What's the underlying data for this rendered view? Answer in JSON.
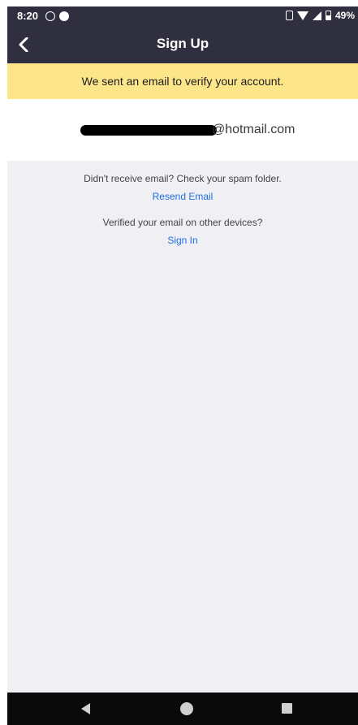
{
  "status_bar": {
    "time": "8:20",
    "battery": "49%",
    "icons": [
      "whatsapp-icon",
      "messenger-icon",
      "vibrate-icon",
      "wifi-icon",
      "signal-icon",
      "battery-icon"
    ]
  },
  "header": {
    "title": "Sign Up",
    "back_icon": "chevron-left-icon"
  },
  "banner": {
    "text": "We sent an email to verify your account.",
    "color": "#fde58a"
  },
  "email": {
    "visible_part": "@hotmail.com"
  },
  "info": {
    "spam_text": "Didn't receive email? Check your spam folder.",
    "resend_label": "Resend Email",
    "verified_text": "Verified your email on other devices?",
    "sign_in_label": "Sign In"
  },
  "colors": {
    "header_bg": "#2f2f3f",
    "link": "#1f6fe0",
    "background": "#efeff4"
  },
  "nav_bar": {
    "icons": [
      "back-triangle-icon",
      "home-circle-icon",
      "recents-square-icon"
    ]
  }
}
